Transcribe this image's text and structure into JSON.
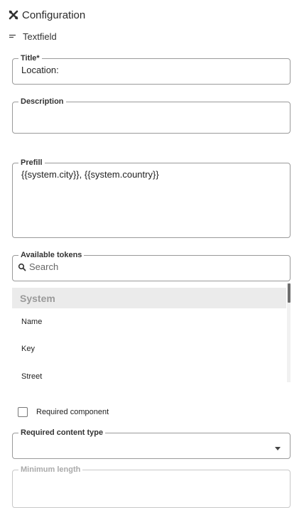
{
  "header": {
    "title": "Configuration",
    "icon": "tools-icon"
  },
  "subheader": {
    "label": "Textfield",
    "icon": "textfield-icon"
  },
  "fields": {
    "title": {
      "label": "Title",
      "required_mark": "*",
      "value": "Location:"
    },
    "description": {
      "label": "Description",
      "value": ""
    },
    "prefill": {
      "label": "Prefill",
      "value": "{{system.city}}, {{system.country}}"
    },
    "tokens": {
      "label": "Available tokens",
      "placeholder": "Search",
      "icon": "search-icon"
    }
  },
  "token_list": {
    "group": "System",
    "items": [
      "Name",
      "Key",
      "Street"
    ]
  },
  "required_component": {
    "label": "Required component",
    "checked": false
  },
  "required_content_type": {
    "label": "Required content type",
    "value": "",
    "icon": "chevron-down-icon"
  },
  "minimum_length": {
    "label": "Minimum length"
  }
}
